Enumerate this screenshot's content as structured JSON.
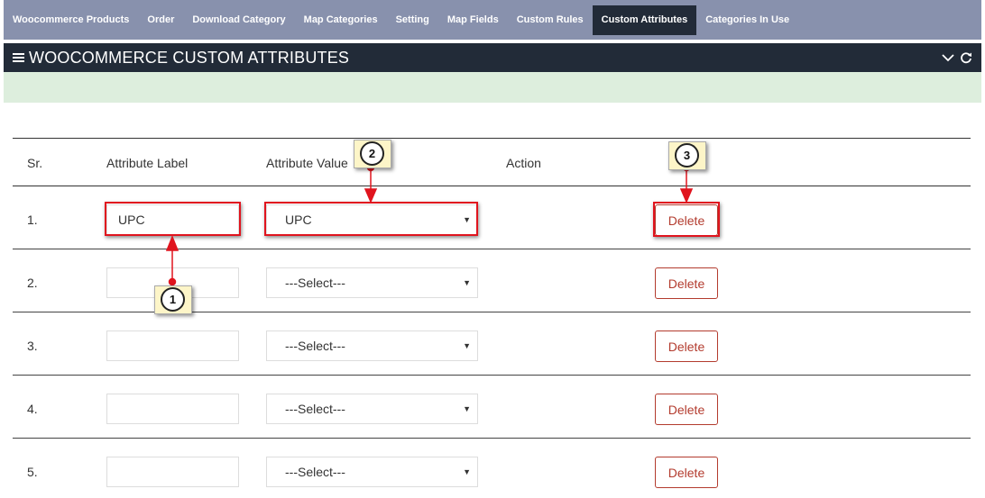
{
  "nav": {
    "tabs": [
      {
        "label": "Woocommerce Products"
      },
      {
        "label": "Order"
      },
      {
        "label": "Download Category"
      },
      {
        "label": "Map Categories"
      },
      {
        "label": "Setting"
      },
      {
        "label": "Map Fields"
      },
      {
        "label": "Custom Rules"
      },
      {
        "label": "Custom Attributes",
        "active": true
      },
      {
        "label": "Categories In Use"
      }
    ]
  },
  "panel": {
    "title": "WOOCOMMERCE CUSTOM ATTRIBUTES",
    "icons": [
      "menu-icon",
      "chevron-down-icon",
      "refresh-icon"
    ]
  },
  "table": {
    "headers": {
      "sr": "Sr.",
      "label": "Attribute Label",
      "value": "Attribute Value",
      "action": "Action"
    },
    "rows": [
      {
        "sr": "1.",
        "label": "UPC",
        "value": "UPC",
        "action": "Delete"
      },
      {
        "sr": "2.",
        "label": "",
        "value": "---Select---",
        "action": "Delete"
      },
      {
        "sr": "3.",
        "label": "",
        "value": "---Select---",
        "action": "Delete"
      },
      {
        "sr": "4.",
        "label": "",
        "value": "---Select---",
        "action": "Delete"
      },
      {
        "sr": "5.",
        "label": "",
        "value": "---Select---",
        "action": "Delete"
      }
    ]
  },
  "annotations": {
    "callouts": [
      "1",
      "2",
      "3"
    ]
  },
  "colors": {
    "nav_bg": "#8891ad",
    "panel_header_bg": "#222b38",
    "message_bar_bg": "#ddeedd",
    "delete_color": "#b33b2e",
    "annotation_red": "#e0141e"
  }
}
